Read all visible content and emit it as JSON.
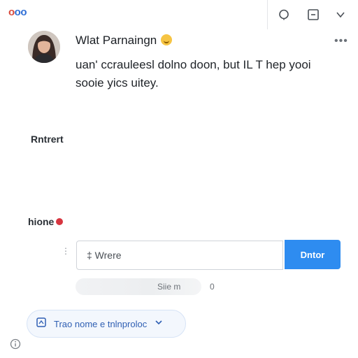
{
  "app": {
    "logo_text": "ooo"
  },
  "toolbar": {
    "icons": [
      "circle-icon",
      "minimize-icon",
      "chevron-down-icon"
    ]
  },
  "message": {
    "author": "Wlat Parnaingn",
    "body": "uan' ccrauleesl dolno doon, but IL T hep yooi sooie yics uitey.",
    "more": "•••"
  },
  "sections": {
    "first_label": "Rntrert",
    "second_label": "hione"
  },
  "input": {
    "placeholder": "‡ Wrere",
    "value": ""
  },
  "enter_button": {
    "label": "Dntor"
  },
  "faded_row": {
    "text": "Siie m",
    "count": "0"
  },
  "pill_button": {
    "label": "Trao nome e tnlnproloc"
  },
  "colors": {
    "accent": "#2e8cf0",
    "pill_text": "#2f5fb3",
    "pill_bg": "#f3f7fd",
    "notification_dot": "#d7353f"
  }
}
